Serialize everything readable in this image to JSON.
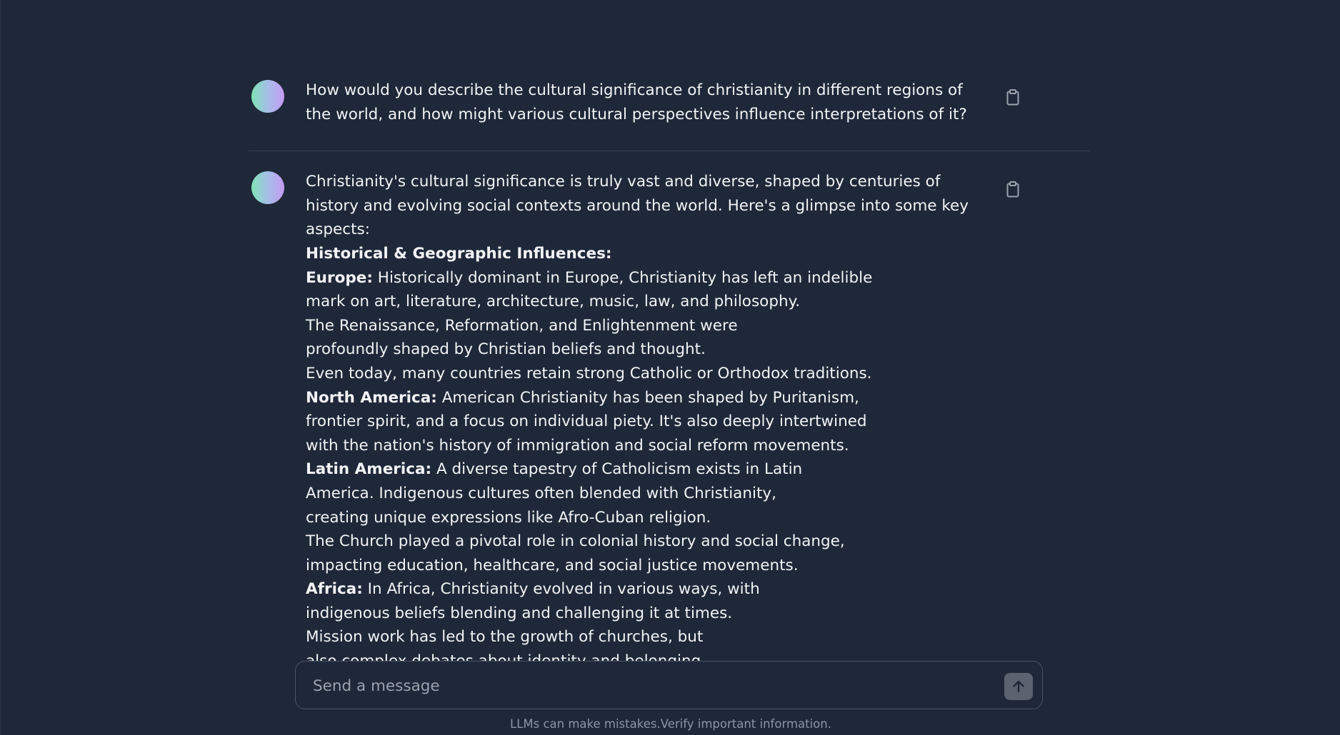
{
  "conversation": {
    "user_message": "How would you describe the cultural significance of christianity in different regions of the world, and how might various cultural perspectives influence interpretations of it?",
    "assistant_message": {
      "intro": "Christianity's cultural significance is truly vast and diverse, shaped by centuries of history and evolving social contexts around the world. Here's a glimpse into some key aspects:",
      "section_heading": "Historical & Geographic Influences:",
      "europe_label": "Europe:",
      "europe_line1": " Historically dominant in Europe, Christianity has left an indelible",
      "europe_line2": "mark on art, literature, architecture, music, law, and philosophy.",
      "europe_line3": "The Renaissance, Reformation, and Enlightenment were",
      "europe_line4": "profoundly shaped by Christian beliefs and thought.",
      "europe_line5": "Even today, many countries retain strong Catholic or Orthodox traditions.",
      "north_america_label": "North America:",
      "north_america_line1": " American Christianity has been shaped by Puritanism,",
      "north_america_line2": "frontier spirit, and a focus on individual piety. It's also deeply intertwined",
      "north_america_line3": "with the nation's history of immigration and social reform movements.",
      "latin_america_label": "Latin America:",
      "latin_america_line1": " A diverse tapestry of Catholicism exists in Latin",
      "latin_america_line2": "America. Indigenous cultures often blended with Christianity,",
      "latin_america_line3": "creating unique expressions like Afro-Cuban religion.",
      "latin_america_line4": "The Church played a pivotal role in colonial history and social change,",
      "latin_america_line5": "impacting education, healthcare, and social justice movements.",
      "africa_label": "Africa:",
      "africa_line1": " In Africa, Christianity evolved in various ways, with",
      "africa_line2": "indigenous beliefs blending and challenging it at times.",
      "africa_line3": "Mission work has led to the growth of churches, but",
      "africa_line4": "also complex debates about identity and belonging."
    }
  },
  "composer": {
    "placeholder": "Send a message",
    "value": ""
  },
  "footer": {
    "disclaimer": "LLMs can make mistakes.Verify important information."
  },
  "icons": {
    "copy": "clipboard-icon",
    "send": "arrow-up-icon"
  },
  "colors": {
    "background": "#1f2838",
    "text": "#f1f3f6",
    "avatar_gradient_start": "#7fe3b5",
    "avatar_gradient_end": "#c49af3",
    "send_button": "#5b6270"
  }
}
